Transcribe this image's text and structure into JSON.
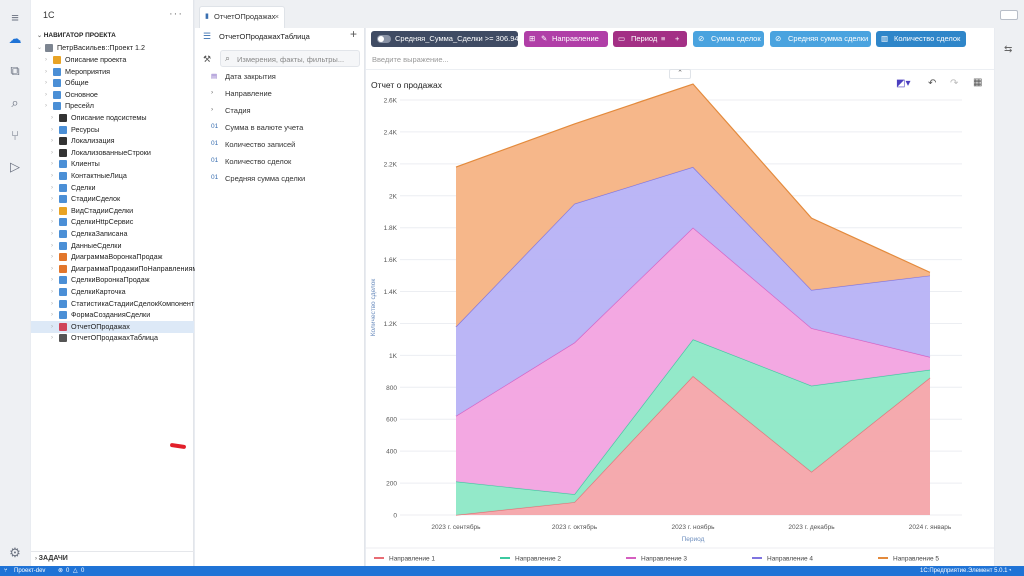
{
  "app": {
    "logo": "1C",
    "tab_title": "ОтчетОПродажах"
  },
  "navigator": {
    "title": "НАВИГАТОР ПРОЕКТА",
    "project": "ПетрВасильев::Проект 1.2",
    "items": [
      {
        "label": "Описание проекта",
        "icon": "description-icon",
        "color": "#e8a325",
        "level": 1
      },
      {
        "label": "Мероприятия",
        "icon": "events-icon",
        "color": "#4b8fd6",
        "level": 1
      },
      {
        "label": "Общие",
        "icon": "common-icon",
        "color": "#4b8fd6",
        "level": 1
      },
      {
        "label": "Основное",
        "icon": "main-icon",
        "color": "#4b8fd6",
        "level": 1
      },
      {
        "label": "Пресейл",
        "icon": "presale-icon",
        "color": "#4b8fd6",
        "level": 1
      },
      {
        "label": "Описание подсистемы",
        "icon": "subsystem-description-icon",
        "color": "#333333",
        "level": 2
      },
      {
        "label": "Ресурсы",
        "icon": "folder-icon",
        "color": "#4b8fd6",
        "level": 2
      },
      {
        "label": "Локализация",
        "icon": "translate-icon",
        "color": "#333333",
        "level": 2
      },
      {
        "label": "ЛокализованныеСтроки",
        "icon": "translate-icon",
        "color": "#333333",
        "level": 2
      },
      {
        "label": "Клиенты",
        "icon": "catalog-icon",
        "color": "#4b8fd6",
        "level": 2
      },
      {
        "label": "КонтактныеЛица",
        "icon": "catalog-icon",
        "color": "#4b8fd6",
        "level": 2
      },
      {
        "label": "Сделки",
        "icon": "catalog-icon",
        "color": "#4b8fd6",
        "level": 2
      },
      {
        "label": "СтадииСделок",
        "icon": "catalog-icon",
        "color": "#4b8fd6",
        "level": 2
      },
      {
        "label": "ВидСтадииСделки",
        "icon": "enum-icon",
        "color": "#e8a325",
        "level": 2
      },
      {
        "label": "СделкиHttpСервис",
        "icon": "http-service-icon",
        "color": "#4b8fd6",
        "level": 2
      },
      {
        "label": "СделкаЗаписана",
        "icon": "event-icon",
        "color": "#4b8fd6",
        "level": 2
      },
      {
        "label": "ДанныеСделки",
        "icon": "register-icon",
        "color": "#4b8fd6",
        "level": 2
      },
      {
        "label": "ДиаграммаВоронкаПродаж",
        "icon": "chart-icon",
        "color": "#e2762b",
        "level": 2
      },
      {
        "label": "ДиаграммаПродажиПоНаправлениям",
        "icon": "chart-icon",
        "color": "#e2762b",
        "level": 2
      },
      {
        "label": "СделкиВоронкаПродаж",
        "icon": "list-icon",
        "color": "#4b8fd6",
        "level": 2
      },
      {
        "label": "СделкиКарточка",
        "icon": "card-icon",
        "color": "#4b8fd6",
        "level": 2
      },
      {
        "label": "СтатистикаСтадииСделокКомпонент",
        "icon": "component-icon",
        "color": "#4b8fd6",
        "level": 2
      },
      {
        "label": "ФормаСозданияСделки",
        "icon": "form-icon",
        "color": "#4b8fd6",
        "level": 2
      },
      {
        "label": "ОтчетОПродажах",
        "icon": "report-icon",
        "color": "#d0455a",
        "level": 2,
        "selected": true
      },
      {
        "label": "ОтчетОПродажахТаблица",
        "icon": "table-report-icon",
        "color": "#555555",
        "level": 2
      }
    ],
    "tasks_label": "ЗАДАЧИ"
  },
  "fields": {
    "title": "ОтчетОПродажахТаблица",
    "search_placeholder": "Измерения, факты, фильтры...",
    "items": [
      {
        "label": "Дата закрытия",
        "icon": "calendar-icon"
      },
      {
        "label": "Направление",
        "icon": "chevron-right-icon"
      },
      {
        "label": "Стадия",
        "icon": "chevron-right-icon"
      },
      {
        "label": "Сумма в валюте учета",
        "icon": "numeric-icon"
      },
      {
        "label": "Количество записей",
        "icon": "numeric-icon"
      },
      {
        "label": "Количество сделок",
        "icon": "numeric-icon"
      },
      {
        "label": "Средняя сумма сделки",
        "icon": "numeric-icon"
      }
    ]
  },
  "toolbar": {
    "chips": [
      {
        "label": "Средняя_Сумма_Сделки >= 306.94",
        "color": "#3f4b63"
      },
      {
        "label": "Направление",
        "color": "#b03ea7"
      },
      {
        "label": "Период",
        "color": "#a32f85"
      },
      {
        "label": "Сумма сделок",
        "color": "#4aa3df"
      },
      {
        "label": "Средняя сумма сделки",
        "color": "#4aa3df"
      },
      {
        "label": "Количество сделок",
        "color": "#2f86c9"
      }
    ],
    "expression_placeholder": "Введите выражение..."
  },
  "report": {
    "title": "Отчет о продажах"
  },
  "chart_data": {
    "type": "area",
    "stacked": true,
    "title": "",
    "xlabel": "Период",
    "ylabel": "Количество сделок",
    "categories": [
      "2023 г. сентябрь",
      "2023 г. октябрь",
      "2023 г. ноябрь",
      "2023 г. декабрь",
      "2024 г. январь"
    ],
    "ylim": [
      0,
      2600
    ],
    "yticks": [
      0,
      200,
      400,
      600,
      800,
      1000,
      1200,
      1400,
      1600,
      1800,
      2000,
      2200,
      2400,
      2600
    ],
    "ytick_labels": [
      "0",
      "200",
      "400",
      "600",
      "800",
      "1K",
      "1.2K",
      "1.4K",
      "1.6K",
      "1.8K",
      "2K",
      "2.2K",
      "2.4K",
      "2.6K"
    ],
    "grid": true,
    "legend_position": "bottom",
    "series": [
      {
        "name": "Направление 1",
        "color": "#e86c74",
        "fill": "#f4a5aa",
        "values": [
          0,
          80,
          870,
          270,
          860
        ]
      },
      {
        "name": "Направление 2",
        "color": "#3cc9a0",
        "fill": "#8de8c6",
        "values": [
          210,
          50,
          230,
          540,
          50
        ]
      },
      {
        "name": "Направление 3",
        "color": "#d55ec0",
        "fill": "#f2a3e0",
        "values": [
          410,
          950,
          700,
          360,
          80
        ]
      },
      {
        "name": "Направление 4",
        "color": "#7f74e0",
        "fill": "#b7b2f5",
        "values": [
          560,
          870,
          380,
          240,
          510
        ]
      },
      {
        "name": "Направление 5",
        "color": "#e38a3c",
        "fill": "#f5b384",
        "values": [
          1000,
          500,
          520,
          450,
          20
        ]
      }
    ]
  },
  "status": {
    "branch": "Проект-dev",
    "errors": "0",
    "warnings": "0",
    "version": "1С:Предприятие.Элемент 5.0.1"
  }
}
